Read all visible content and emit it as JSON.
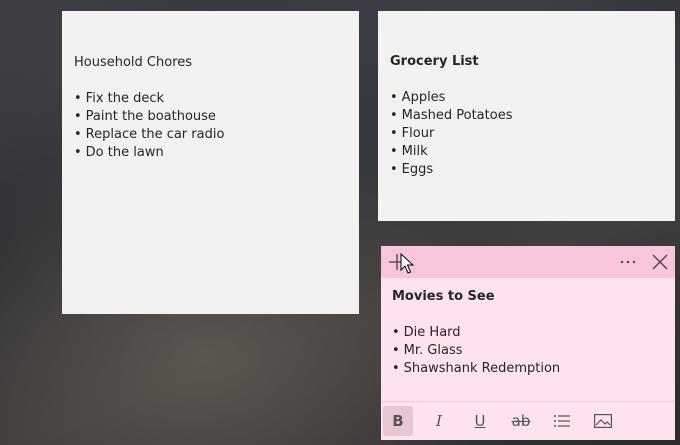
{
  "notes": {
    "chores": {
      "title": "Household Chores",
      "items": [
        "Fix the deck",
        "Paint the boathouse",
        "Replace the car radio",
        "Do the lawn"
      ]
    },
    "grocery": {
      "title": "Grocery List",
      "items": [
        "Apples",
        "Mashed Potatoes",
        "Flour",
        "Milk",
        "Eggs"
      ]
    },
    "movies": {
      "title": "Movies to See",
      "items": [
        "Die Hard",
        "Mr. Glass",
        "Shawshank Redemption"
      ],
      "color": "#fde3ef",
      "header_color": "#f8c5dd",
      "toolbar": {
        "bold_label": "B",
        "italic_label": "I",
        "underline_label": "U",
        "strike_label": "ab",
        "bold_active": true
      },
      "header_icons": [
        "add-icon",
        "more-icon",
        "close-icon"
      ],
      "toolbar_icons": [
        "bullets-icon",
        "image-icon"
      ]
    }
  }
}
